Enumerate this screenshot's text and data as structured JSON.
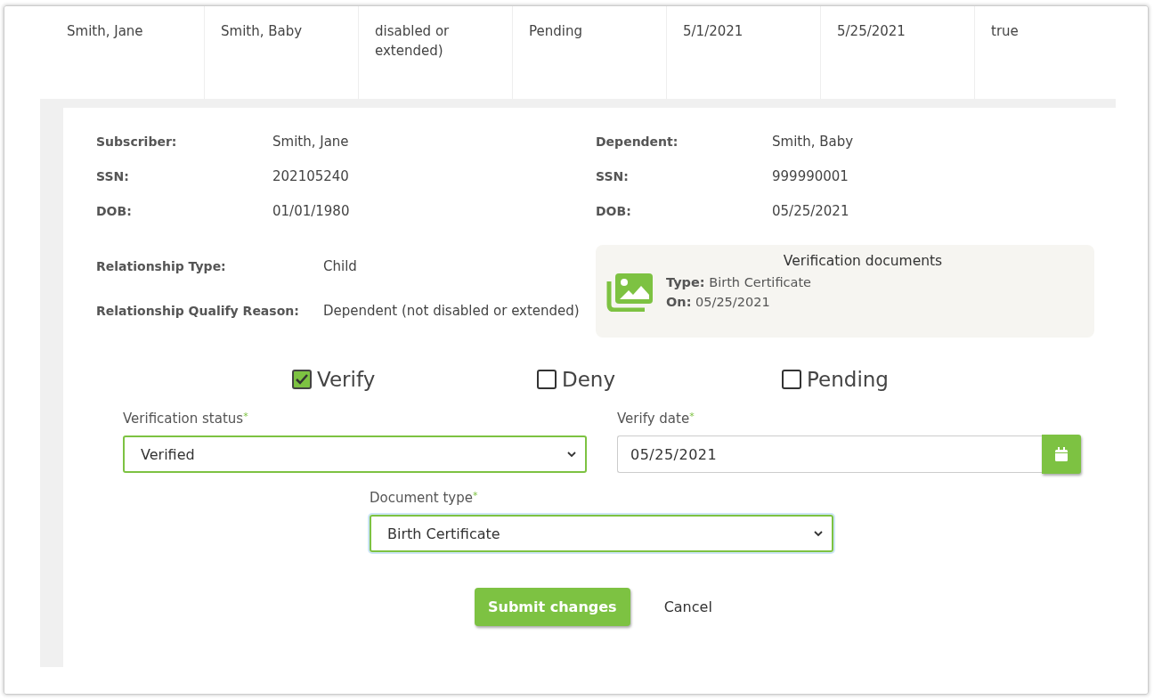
{
  "table_row": {
    "cells": [
      "Smith, Jane",
      "Smith, Baby",
      "disabled or extended)",
      "Pending",
      "5/1/2021",
      "5/25/2021",
      "true"
    ]
  },
  "subscriber": [
    {
      "label": "Subscriber:",
      "value": "Smith, Jane"
    },
    {
      "label": "SSN:",
      "value": "202105240"
    },
    {
      "label": "DOB:",
      "value": "01/01/1980"
    }
  ],
  "dependent": [
    {
      "label": "Dependent:",
      "value": "Smith, Baby"
    },
    {
      "label": "SSN:",
      "value": "999990001"
    },
    {
      "label": "DOB:",
      "value": "05/25/2021"
    }
  ],
  "relationship": [
    {
      "label": "Relationship Type:",
      "value": "Child"
    },
    {
      "label": "Relationship Qualify Reason:",
      "value": "Dependent (not disabled or extended)"
    }
  ],
  "verification_documents": {
    "title": "Verification documents",
    "text": "**Type:** Birth Certificate",
    "date": "**On:** 05/25/2021"
  },
  "statuses": [
    {
      "label": "Verify",
      "checked": true
    },
    {
      "label": "Deny",
      "checked": false
    },
    {
      "label": "Pending",
      "checked": false
    }
  ],
  "verification_status": {
    "label": "Verification status",
    "required_mark": "*",
    "value": "Verified"
  },
  "verify_date": {
    "label": "Verify date",
    "required_mark": "*",
    "value": "05/25/2021"
  },
  "document_type": {
    "label": "Document type",
    "required_mark": "*",
    "value": "Birth Certificate"
  },
  "buttons": {
    "submit": "Submit changes",
    "cancel": "Cancel"
  }
}
